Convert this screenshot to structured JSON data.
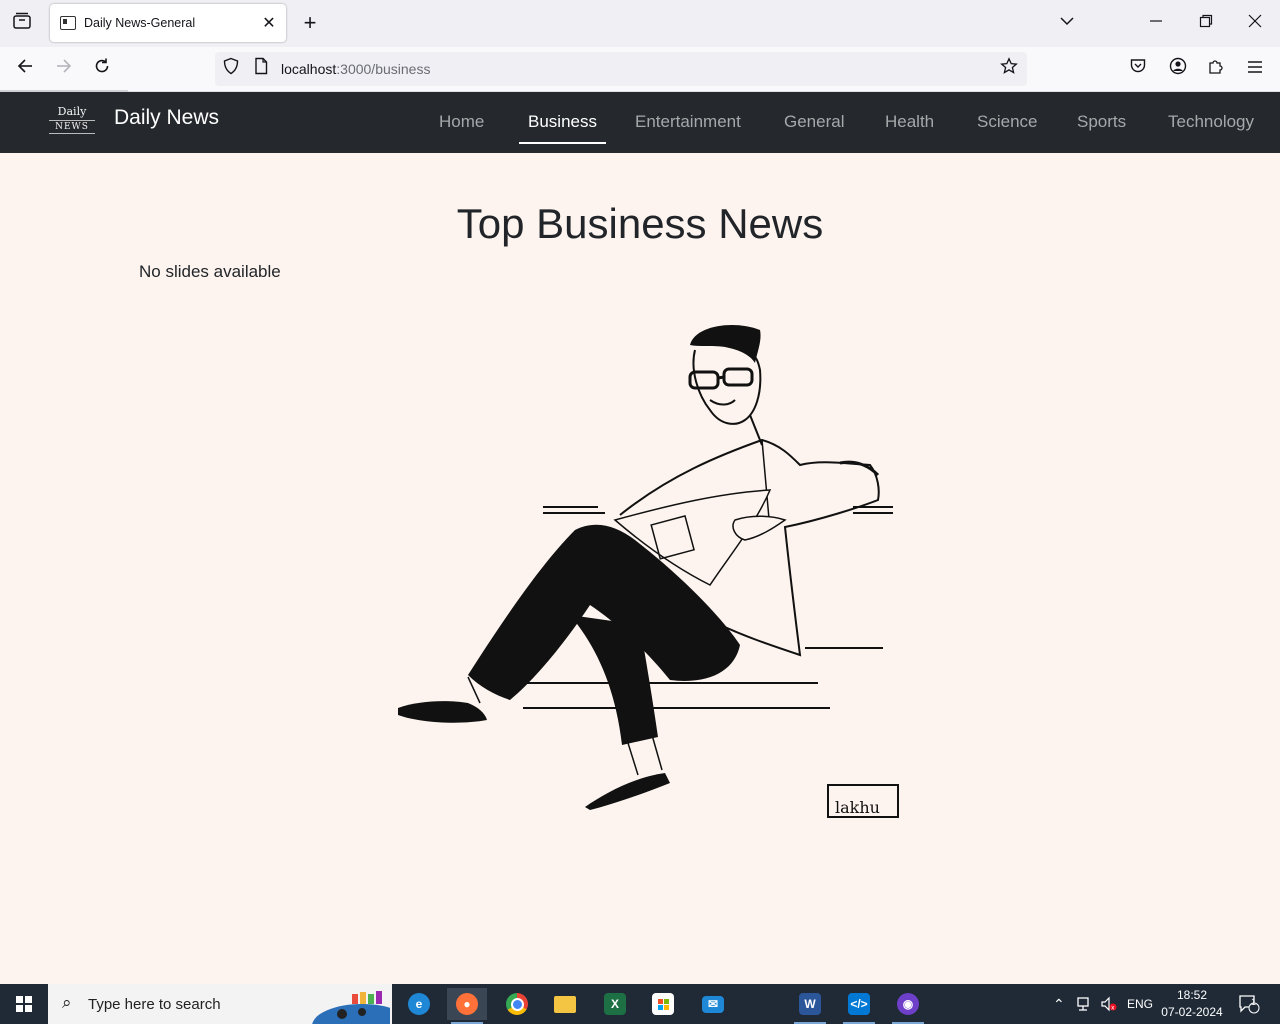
{
  "browser": {
    "tab_title": "Daily News-General",
    "url_host": "localhost",
    "url_rest": ":3000/business"
  },
  "site": {
    "logo_line1": "Daily",
    "logo_line2": "NEWS",
    "brand": "Daily News",
    "nav": [
      "Home",
      "Business",
      "Entertainment",
      "General",
      "Health",
      "Science",
      "Sports",
      "Technology"
    ],
    "active_nav": "Business"
  },
  "main": {
    "headline": "Top Business News",
    "empty_message": "No slides available",
    "illustration_signature": "lakhu"
  },
  "taskbar": {
    "search_placeholder": "Type here to search",
    "language": "ENG",
    "time": "18:52",
    "date": "07-02-2024",
    "notifications": "1"
  }
}
